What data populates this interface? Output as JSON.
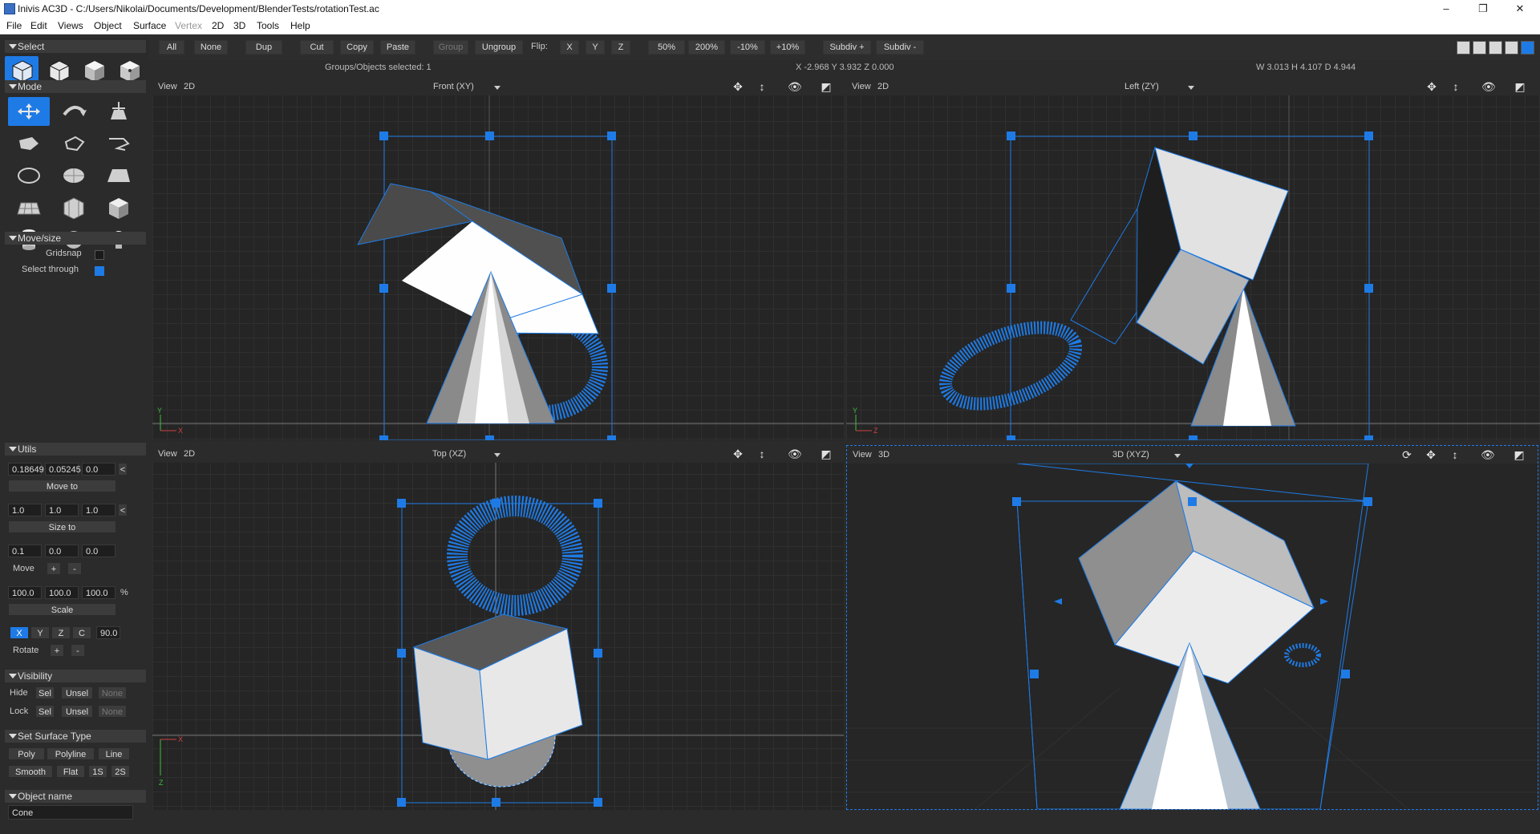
{
  "window": {
    "title": "Inivis AC3D - C:/Users/Nikolai/Documents/Development/BlenderTests/rotationTest.ac",
    "minimize": "–",
    "maximize": "❐",
    "close": "✕"
  },
  "menu": [
    "File",
    "Edit",
    "Views",
    "Object",
    "Surface",
    "Vertex",
    "2D",
    "3D",
    "Tools",
    "Help"
  ],
  "toolbar": {
    "all": "All",
    "none": "None",
    "dup": "Dup",
    "cut": "Cut",
    "copy": "Copy",
    "paste": "Paste",
    "group": "Group",
    "ungroup": "Ungroup",
    "flip": "Flip:",
    "x": "X",
    "y": "Y",
    "z": "Z",
    "zoom50": "50%",
    "zoom200": "200%",
    "minus10": "-10%",
    "plus10": "+10%",
    "subdiv_plus": "Subdiv +",
    "subdiv_minus": "Subdiv -"
  },
  "info": {
    "selected": "Groups/Objects selected: 1",
    "coords": "X -2.968 Y 3.932 Z 0.000",
    "dims": "W 3.013 H 4.107 D 4.944"
  },
  "panel": {
    "select": "Select",
    "mode": "Mode",
    "movesize": "Move/size",
    "gridsnap": "Gridsnap",
    "select_through": "Select through",
    "utils": "Utils",
    "pos": [
      "0.18649",
      "0.05245",
      "0.0"
    ],
    "move_to": "Move to",
    "size": [
      "1.0",
      "1.0",
      "1.0"
    ],
    "size_to": "Size to",
    "move": [
      "0.1",
      "0.0",
      "0.0"
    ],
    "move_label": "Move",
    "plus": "+",
    "minus": "-",
    "scale": [
      "100.0",
      "100.0",
      "100.0"
    ],
    "pct": "%",
    "scale_label": "Scale",
    "axis_x": "X",
    "axis_y": "Y",
    "axis_z": "Z",
    "axis_c": "C",
    "angle": "90.0",
    "rotate": "Rotate",
    "lt": "<",
    "visibility": "Visibility",
    "hide": "Hide",
    "lock": "Lock",
    "sel": "Sel",
    "unsel": "Unsel",
    "none": "None",
    "surface_type": "Set Surface Type",
    "poly": "Poly",
    "polyline": "Polyline",
    "line": "Line",
    "smooth": "Smooth",
    "flat": "Flat",
    "s1": "1S",
    "s2": "2S",
    "object_name": "Object name",
    "name_value": "Cone"
  },
  "viewports": [
    {
      "view": "View",
      "mode": "2D",
      "name": "Front (XY)",
      "axis_h": "X",
      "axis_v": "Y"
    },
    {
      "view": "View",
      "mode": "2D",
      "name": "Left (ZY)",
      "axis_h": "Z",
      "axis_v": "Y"
    },
    {
      "view": "View",
      "mode": "2D",
      "name": "Top (XZ)",
      "axis_h": "X",
      "axis_v": "Z"
    },
    {
      "view": "View",
      "mode": "3D",
      "name": "3D (XYZ)"
    }
  ],
  "colors": {
    "accent": "#1e7be6",
    "selection": "#1e7be6",
    "bg": "#2b2b2b",
    "viewport": "#252525"
  }
}
